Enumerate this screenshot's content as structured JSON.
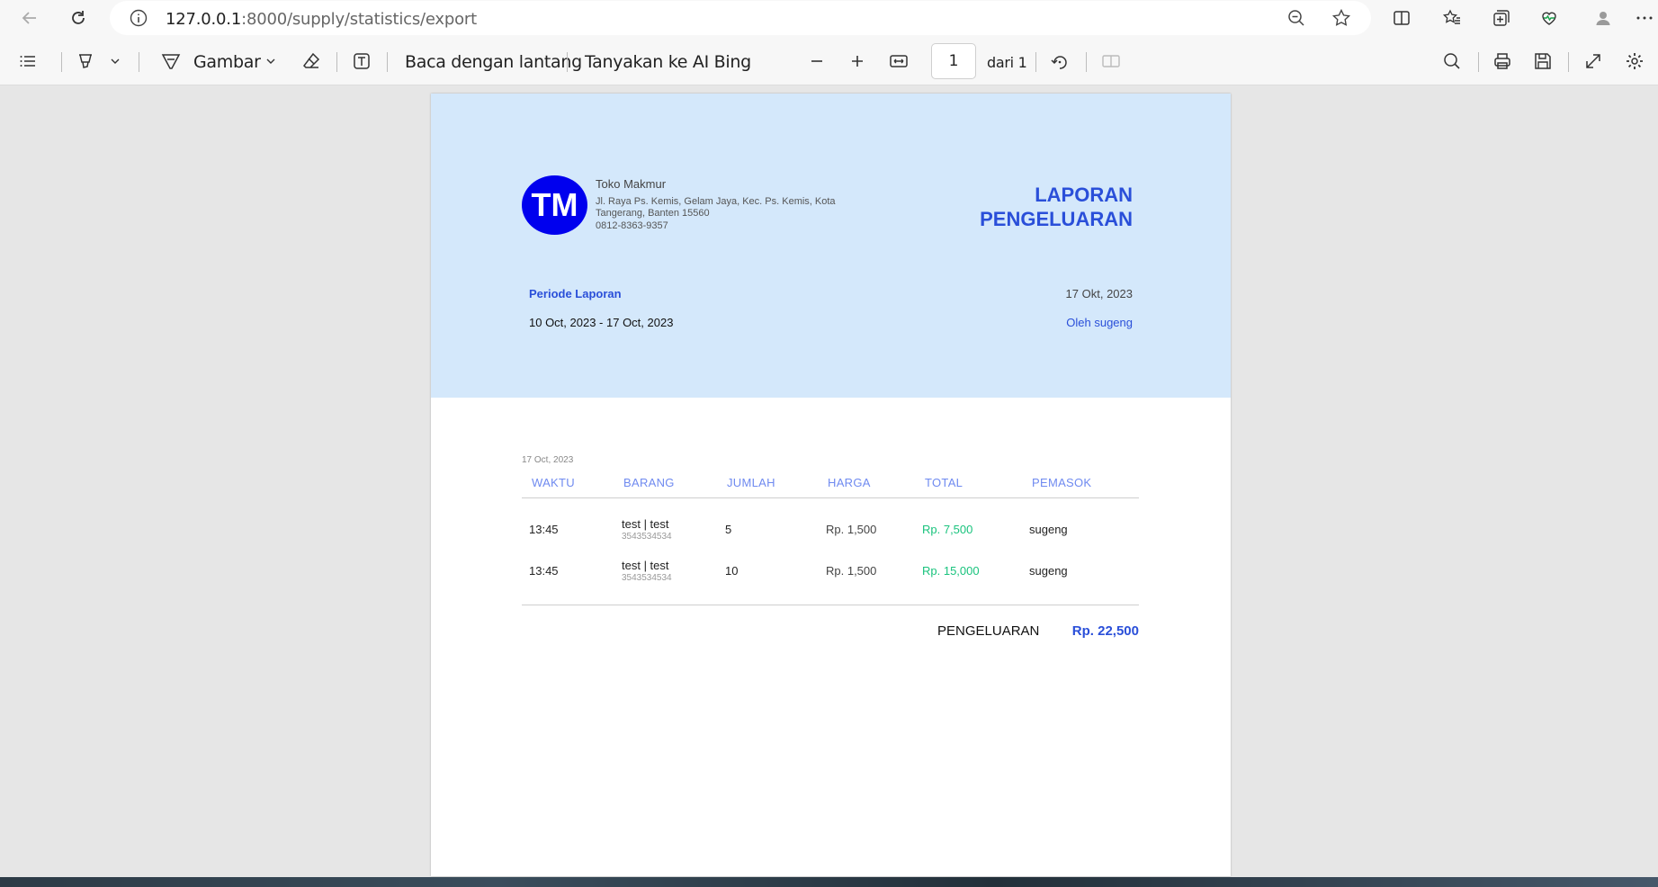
{
  "browser": {
    "url_host": "127.0.0.1",
    "url_path": ":8000/supply/statistics/export"
  },
  "toolbar": {
    "draw_label": "Gambar",
    "read_aloud_label": "Baca dengan lantang",
    "ask_ai_label": "Tanyakan ke AI Bing",
    "page_number": "1",
    "page_total": "dari 1"
  },
  "report": {
    "logo_text": "TM",
    "shop_name": "Toko Makmur",
    "shop_address": "Jl. Raya Ps. Kemis, Gelam Jaya, Kec. Ps. Kemis, Kota Tangerang, Banten 15560",
    "shop_phone": "0812-8363-9357",
    "title_line1": "LAPORAN",
    "title_line2": "PENGELUARAN",
    "period_label": "Periode Laporan",
    "period_value": "10 Oct, 2023 - 17 Oct, 2023",
    "generated_date": "17 Okt, 2023",
    "generated_by": "Oleh sugeng",
    "group_date": "17 Oct, 2023",
    "columns": [
      "WAKTU",
      "BARANG",
      "JUMLAH",
      "HARGA",
      "TOTAL",
      "PEMASOK"
    ],
    "rows": [
      {
        "time": "13:45",
        "item": "test | test",
        "item_code": "3543534534",
        "qty": "5",
        "price": "Rp. 1,500",
        "total": "Rp. 7,500",
        "supplier": "sugeng"
      },
      {
        "time": "13:45",
        "item": "test | test",
        "item_code": "3543534534",
        "qty": "10",
        "price": "Rp. 1,500",
        "total": "Rp. 15,000",
        "supplier": "sugeng"
      }
    ],
    "summary_label": "PENGELUARAN",
    "summary_value": "Rp. 22,500"
  },
  "colors": {
    "accent": "#2a4fd9",
    "hero_bg": "#d4e8fb",
    "logo_bg": "#0000ee",
    "total_green": "#19c37d"
  },
  "icons": [
    "back-icon",
    "reload-icon",
    "info-icon",
    "zoom-out-icon",
    "favorite-star-icon",
    "split-screen-icon",
    "favorites-icon",
    "collections-icon",
    "health-icon",
    "profile-icon",
    "more-icon",
    "contents-icon",
    "highlight-icon",
    "chevron-down-icon",
    "draw-icon",
    "eraser-icon",
    "text-icon",
    "minus-icon",
    "plus-icon",
    "fit-width-icon",
    "rotate-icon",
    "two-page-icon",
    "search-icon",
    "print-icon",
    "save-icon",
    "fullscreen-icon",
    "settings-icon"
  ]
}
